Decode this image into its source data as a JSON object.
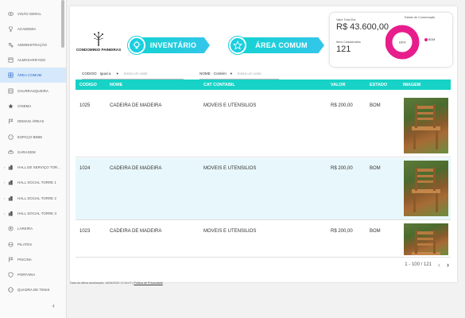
{
  "sidebar": {
    "items": [
      {
        "label": "VISÃO GERAL",
        "icon": "eye-icon",
        "caret": false,
        "active": false
      },
      {
        "label": "ACADEMIA",
        "icon": "trophy-icon",
        "caret": false,
        "active": false
      },
      {
        "label": "ADMINISTRAÇÃO",
        "icon": "gears-icon",
        "caret": false,
        "active": false
      },
      {
        "label": "ALMOXARIFADO",
        "icon": "box-icon",
        "caret": false,
        "active": false
      },
      {
        "label": "ÁREA COMUM",
        "icon": "grid-icon",
        "caret": false,
        "active": true
      },
      {
        "label": "CHURRASQUEIRA",
        "icon": "grill-icon",
        "caret": false,
        "active": false
      },
      {
        "label": "CINEMA",
        "icon": "star-icon",
        "caret": false,
        "active": false
      },
      {
        "label": "DEMAIS ÁREAS",
        "icon": "flag-icon",
        "caret": false,
        "active": false
      },
      {
        "label": "ESPAÇO BEBE",
        "icon": "baby-icon",
        "caret": false,
        "active": false
      },
      {
        "label": "GARAGEM",
        "icon": "car-icon",
        "caret": false,
        "active": false
      },
      {
        "label": "HALL DE SERVIÇO TOR...",
        "icon": "building-icon",
        "caret": true,
        "active": false
      },
      {
        "label": "HALL SOCIAL TORRE 1",
        "icon": "building-icon",
        "caret": true,
        "active": false
      },
      {
        "label": "HALL SOCIAL TORRE 2",
        "icon": "building-icon",
        "caret": true,
        "active": false
      },
      {
        "label": "HALL SOCIAL TORRE 3",
        "icon": "building-icon",
        "caret": true,
        "active": false
      },
      {
        "label": "LAREIRA",
        "icon": "fire-icon",
        "caret": false,
        "active": false
      },
      {
        "label": "PILATES",
        "icon": "pilates-icon",
        "caret": false,
        "active": false
      },
      {
        "label": "PISCINA",
        "icon": "flag-icon",
        "caret": false,
        "active": false
      },
      {
        "label": "PORTARIA",
        "icon": "shield-icon",
        "caret": false,
        "active": false
      },
      {
        "label": "QUADRA DE TENIS",
        "icon": "tennis-icon",
        "caret": false,
        "active": false
      }
    ],
    "collapse_label": "‹"
  },
  "header": {
    "logo_text": "CONDOMINIO PAINEIRAS",
    "banner_inventario": "INVENTÁRIO",
    "banner_area": "ÁREA COMUM"
  },
  "stats": {
    "total_label": "Valor Total Est.",
    "total_value": "R$ 43.600,00",
    "items_label": "Itens Cadastrados",
    "items_value": "121",
    "donut_title": "Estado de Conservação",
    "donut_center": "100%",
    "legend_bom": "BOM",
    "color_accent": "#e71d8c"
  },
  "filters": {
    "codigo": {
      "label": "CODIGO",
      "operator": "Igual a",
      "placeholder": "Insira um valor"
    },
    "nome": {
      "label": "NOME",
      "operator": "Contém",
      "placeholder": "Insira um valor"
    }
  },
  "table": {
    "headers": [
      "CODIGO",
      "NOME",
      "CAT CONTABIL",
      "VALOR",
      "ESTADO",
      "IMAGEM"
    ],
    "rows": [
      {
        "codigo": "1025",
        "nome": "CADEIRA DE MADEIRA",
        "cat": "MOVEIS E UTENSILIOS",
        "valor": "R$ 200,00",
        "estado": "BOM"
      },
      {
        "codigo": "1024",
        "nome": "CADEIRA DE MADEIRA",
        "cat": "MOVEIS E UTENSILIOS",
        "valor": "R$ 200,00",
        "estado": "BOM"
      },
      {
        "codigo": "1023",
        "nome": "CADEIRA DE MADEIRA",
        "cat": "MOVEIS E UTENSILIOS",
        "valor": "R$ 200,00",
        "estado": "BOM"
      }
    ],
    "header_color": "#17d2c6"
  },
  "pagination": {
    "range": "1 - 100 / 121",
    "prev": "‹",
    "next": "›"
  },
  "footer": {
    "text": "Data da última atualização: 16/04/2020 17:24:07",
    "link": "Política de Privacidade"
  }
}
